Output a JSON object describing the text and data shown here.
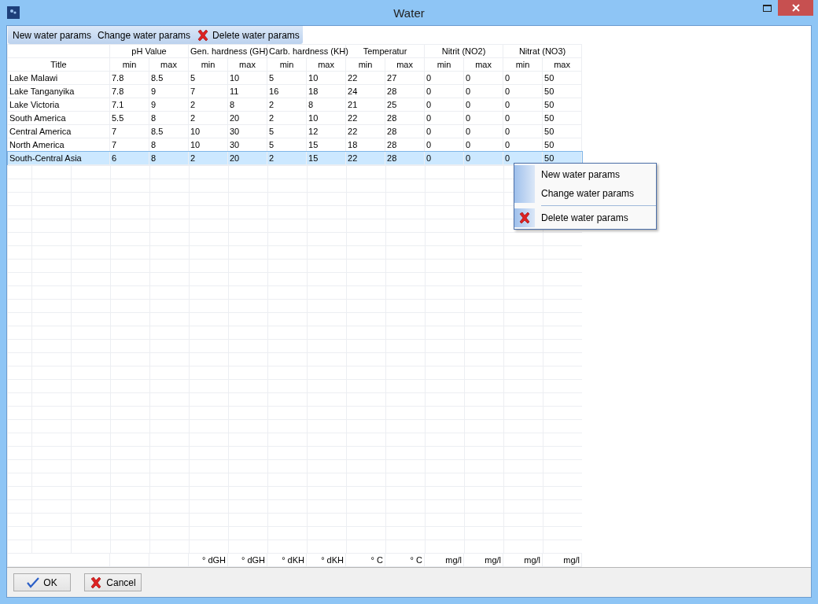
{
  "window": {
    "title": "Water"
  },
  "toolbar": [
    {
      "label": "New water params",
      "kind": "plain"
    },
    {
      "label": "Change water params",
      "kind": "plain"
    },
    {
      "label": "Delete water params",
      "kind": "delete"
    }
  ],
  "table": {
    "title_column": "Title",
    "groups": [
      {
        "label": "pH Value",
        "columns": [
          "min",
          "max"
        ]
      },
      {
        "label": "Gen. hardness (GH)",
        "columns": [
          "min",
          "max"
        ]
      },
      {
        "label": "Carb. hardness (KH)",
        "columns": [
          "min",
          "max"
        ]
      },
      {
        "label": "Temperatur",
        "columns": [
          "min",
          "max"
        ]
      },
      {
        "label": "Nitrit (NO2)",
        "columns": [
          "min",
          "max"
        ]
      },
      {
        "label": "Nitrat (NO3)",
        "columns": [
          "min",
          "max"
        ]
      }
    ],
    "rows": [
      {
        "title": "Lake Malawi",
        "values": [
          "7.8",
          "8.5",
          "5",
          "10",
          "5",
          "10",
          "22",
          "27",
          "0",
          "0",
          "0",
          "50"
        ],
        "selected": false
      },
      {
        "title": "Lake Tanganyika",
        "values": [
          "7.8",
          "9",
          "7",
          "11",
          "16",
          "18",
          "24",
          "28",
          "0",
          "0",
          "0",
          "50"
        ],
        "selected": false
      },
      {
        "title": "Lake Victoria",
        "values": [
          "7.1",
          "9",
          "2",
          "8",
          "2",
          "8",
          "21",
          "25",
          "0",
          "0",
          "0",
          "50"
        ],
        "selected": false
      },
      {
        "title": "South America",
        "values": [
          "5.5",
          "8",
          "2",
          "20",
          "2",
          "10",
          "22",
          "28",
          "0",
          "0",
          "0",
          "50"
        ],
        "selected": false
      },
      {
        "title": "Central America",
        "values": [
          "7",
          "8.5",
          "10",
          "30",
          "5",
          "12",
          "22",
          "28",
          "0",
          "0",
          "0",
          "50"
        ],
        "selected": false
      },
      {
        "title": "North America",
        "values": [
          "7",
          "8",
          "10",
          "30",
          "5",
          "15",
          "18",
          "28",
          "0",
          "0",
          "0",
          "50"
        ],
        "selected": false
      },
      {
        "title": "South-Central Asia",
        "values": [
          "6",
          "8",
          "2",
          "20",
          "2",
          "15",
          "22",
          "28",
          "0",
          "0",
          "0",
          "50"
        ],
        "selected": true
      }
    ],
    "units": [
      "° dGH",
      "° dGH",
      "° dKH",
      "° dKH",
      "° C",
      "° C",
      "mg/l",
      "mg/l",
      "mg/l",
      "mg/l"
    ]
  },
  "context_menu": {
    "items": [
      {
        "label": "New water params",
        "kind": "plain",
        "separator_before": false
      },
      {
        "label": "Change water params",
        "kind": "plain",
        "separator_before": false
      },
      {
        "label": "Delete water params",
        "kind": "delete",
        "separator_before": true
      }
    ]
  },
  "buttons": [
    {
      "label": "OK",
      "kind": "ok"
    },
    {
      "label": "Cancel",
      "kind": "cancel"
    }
  ]
}
